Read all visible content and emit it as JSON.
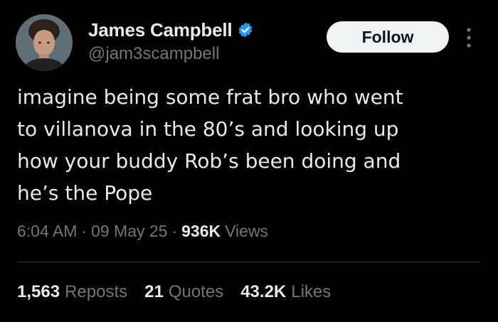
{
  "author": {
    "display_name": "James Campbell",
    "handle": "@jam3scampbell",
    "verified": true
  },
  "actions": {
    "follow_label": "Follow",
    "more_icon": "more-vertical-icon"
  },
  "tweet": {
    "text": "imagine being some frat bro who went\nto villanova in the 80’s and looking up\nhow your buddy Rob’s been doing and\nhe’s the Pope",
    "time": "6:04 AM",
    "date": "09 May 25",
    "views_count": "936K",
    "views_label": "Views"
  },
  "stats": [
    {
      "count": "1,563",
      "label": "Reposts"
    },
    {
      "count": "21",
      "label": "Quotes"
    },
    {
      "count": "43.2K",
      "label": "Likes"
    }
  ],
  "colors": {
    "background": "#000000",
    "primary_text": "#e7e9ea",
    "secondary_text": "#71767b",
    "verified_blue": "#1d9bf0",
    "divider": "#2f3336",
    "follow_bg": "#eff3f4"
  }
}
